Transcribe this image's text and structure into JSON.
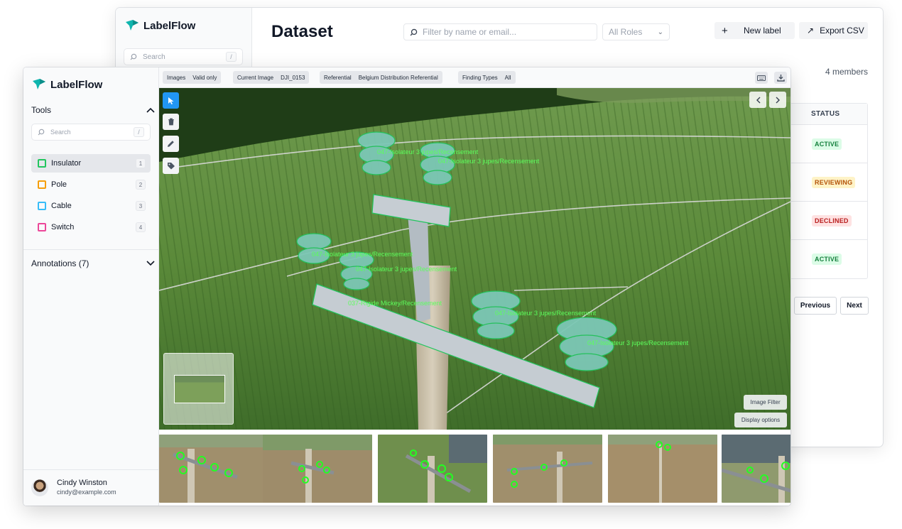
{
  "back": {
    "brand": "LabelFlow",
    "search_placeholder": "Search",
    "search_shortcut": "/",
    "title": "Dataset",
    "filter_placeholder": "Filter by name or email...",
    "roles_select": "All Roles",
    "new_label_button": "New label",
    "export_button": "Export CSV",
    "members_count": "4 members",
    "status_header": "STATUS",
    "statuses": [
      "ACTIVE",
      "REVIEWING",
      "DECLINED",
      "ACTIVE"
    ],
    "previous_button": "Previous",
    "next_button": "Next"
  },
  "front": {
    "brand": "LabelFlow",
    "tools_heading": "Tools",
    "search_placeholder": "Search",
    "search_shortcut": "/",
    "tools": [
      {
        "label": "Insulator",
        "key": "1",
        "color": "#22c55e"
      },
      {
        "label": "Pole",
        "key": "2",
        "color": "#f59e0b"
      },
      {
        "label": "Cable",
        "key": "3",
        "color": "#38bdf8"
      },
      {
        "label": "Switch",
        "key": "4",
        "color": "#ec4899"
      }
    ],
    "annotations_heading": "Annotations (7)",
    "user": {
      "name": "Cindy Winston",
      "email": "cindy@example.com"
    },
    "filters": [
      {
        "name": "Images",
        "value": "Valid only"
      },
      {
        "name": "Current Image",
        "value": "DJI_0153"
      },
      {
        "name": "Referential",
        "value": "Belgium Distribution Referential"
      },
      {
        "name": "Finding Types",
        "value": "All"
      }
    ],
    "image_filter_button": "Image Filter",
    "display_options_button": "Display options",
    "annotation_labels": [
      "047-Isolateur 3 jupes/Recensement",
      "047-Isolateur 3 jupes/Recensement",
      "047-Isolateur 3 jupes/Recensement",
      "047-Isolateur 3 jupes/Recensement",
      "037-Rigide Mickey/Recensement",
      "047-Isolateur 3 jupes/Recensement",
      "047-Isolateur 3 jupes/Recensement"
    ],
    "accent_color": "#2196f3",
    "annotation_color": "#22c55e"
  }
}
